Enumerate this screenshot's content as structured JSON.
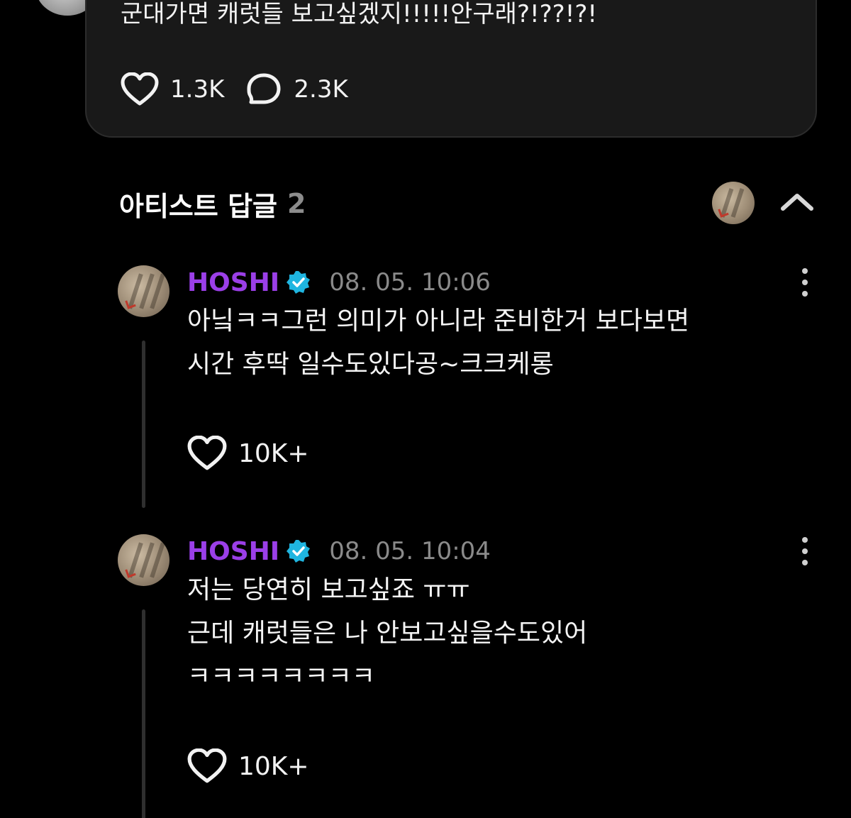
{
  "post": {
    "text": "군대가면 캐럿들 보고싶겠지!!!!!안구래?!??!?!",
    "like_count": "1.3K",
    "comment_count": "2.3K"
  },
  "section": {
    "title": "아티스트 답글",
    "count": "2"
  },
  "replies": [
    {
      "author": "HOSHI",
      "timestamp": "08. 05. 10:06",
      "body": "아닠ㅋㅋ그런 의미가 아니라 준비한거 보다보면\n시간 후딱 일수도있다공~크크케롱",
      "like_count": "10K+"
    },
    {
      "author": "HOSHI",
      "timestamp": "08. 05. 10:04",
      "body": "저는 당연히 보고싶죠 ㅠㅠ\n근데 캐럿들은 나 안보고싶을수도있어\nㅋㅋㅋㅋㅋㅋㅋㅋ",
      "like_count": "10K+"
    }
  ],
  "colors": {
    "background": "#000000",
    "card": "#191919",
    "author": "#9b3fe8",
    "verified_badge": "#1fb5e0",
    "muted": "#8a8a8a"
  },
  "icons": {
    "like": "heart-icon",
    "comment": "speech-bubble-icon",
    "collapse": "chevron-up-icon",
    "more": "vertical-ellipsis-icon",
    "verified": "verified-badge-icon"
  }
}
